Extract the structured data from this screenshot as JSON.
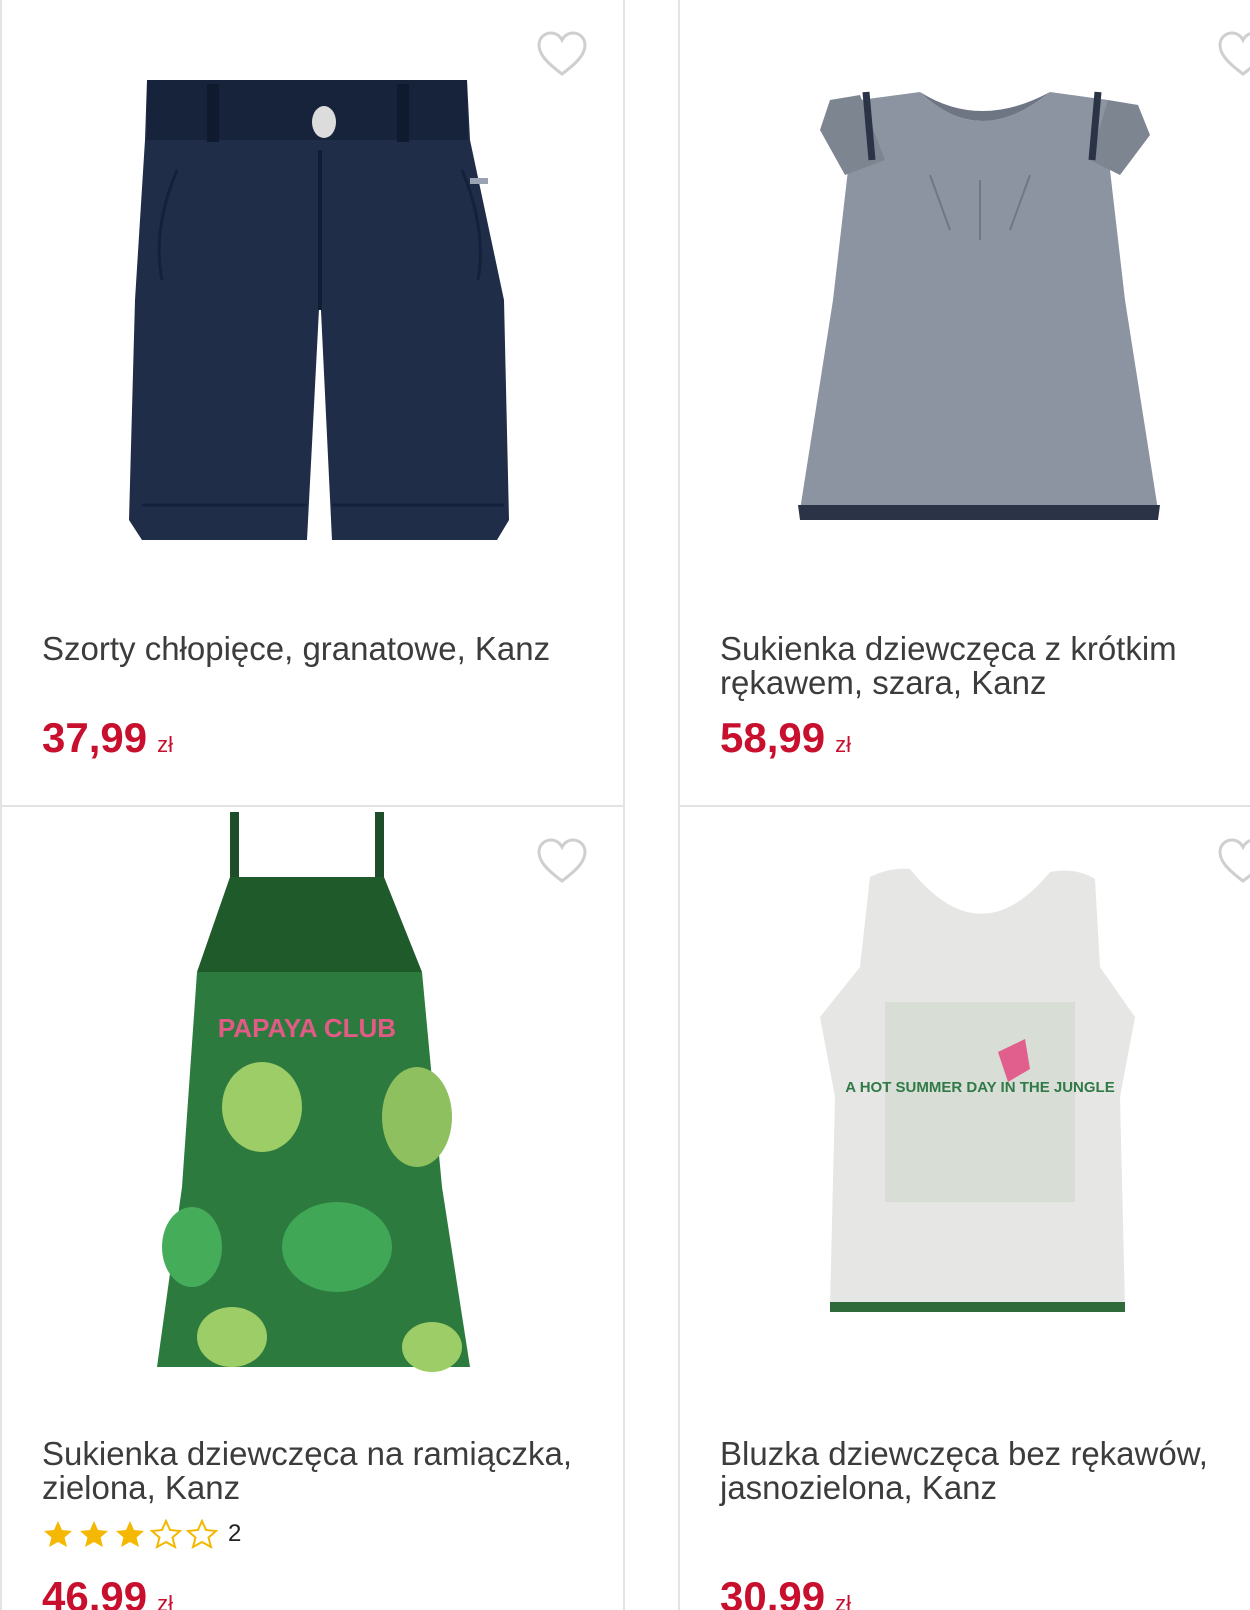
{
  "products": [
    {
      "title": "Szorty chłopięce, granatowe, Kanz",
      "price": "37,99",
      "currency": "zł",
      "image_icon": "navy-shorts-image"
    },
    {
      "title": "Sukienka dziewczęca z krótkim rękawem, szara, Kanz",
      "price": "58,99",
      "currency": "zł",
      "image_icon": "grey-dress-image"
    },
    {
      "title": "Sukienka dziewczęca na ramiączka, zielona, Kanz",
      "price": "46,99",
      "currency": "zł",
      "rating": 3,
      "rating_max": 5,
      "review_count": "2",
      "image_icon": "green-dress-image",
      "print_text": "PAPAYA CLUB"
    },
    {
      "title": "Bluzka dziewczęca bez rękawów, jasnozielona, Kanz",
      "price": "30,99",
      "currency": "zł",
      "image_icon": "white-tank-top-image",
      "print_text": "A HOT SUMMER DAY IN THE JUNGLE"
    }
  ],
  "colors": {
    "price": "#c8102e",
    "star_filled": "#f5b800",
    "heart_outline": "#cfcfcf",
    "title": "#3c3c3c"
  }
}
